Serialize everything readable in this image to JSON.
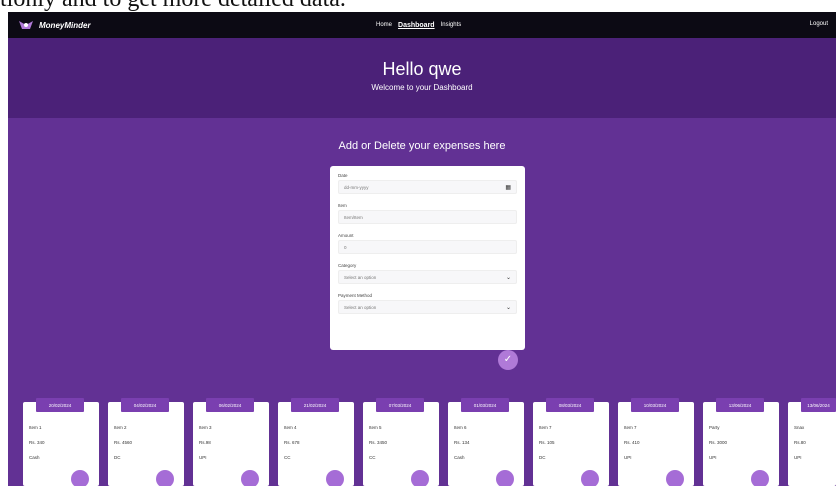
{
  "caption": "tionly and to get more detailed data.",
  "navbar": {
    "brand": "MoneyMinder",
    "links": [
      "Home",
      "Dashboard",
      "Insights"
    ],
    "logout": "Logout"
  },
  "hero": {
    "title": "Hello qwe",
    "subtitle": "Welcome to your Dashboard"
  },
  "section_title": "Add or Delete your expenses here",
  "form": {
    "date_label": "Date",
    "date_value": "dd-mm-yyyy",
    "item_label": "Item",
    "item_placeholder": "Item/Item",
    "amount_label": "Amount",
    "amount_value": "0",
    "category_label": "Category",
    "category_value": "Select an option",
    "payment_label": "Payment Method",
    "payment_value": "Select an option"
  },
  "expenses": [
    {
      "date": "20/02/2024",
      "item": "Item 1",
      "amount": "Rs. 340",
      "method": "Cash"
    },
    {
      "date": "04/02/2024",
      "item": "Item 2",
      "amount": "Rs. 4560",
      "method": "DC"
    },
    {
      "date": "06/02/2024",
      "item": "Item 3",
      "amount": "Rs.98",
      "method": "UPI"
    },
    {
      "date": "21/02/2024",
      "item": "Item 4",
      "amount": "Rs. 678",
      "method": "CC"
    },
    {
      "date": "07/03/2024",
      "item": "Item 5",
      "amount": "Rs. 3450",
      "method": "CC"
    },
    {
      "date": "01/03/2024",
      "item": "Item 6",
      "amount": "Rs. 134",
      "method": "Cash"
    },
    {
      "date": "08/03/2024",
      "item": "Item 7",
      "amount": "Rs. 105",
      "method": "DC"
    },
    {
      "date": "10/03/2024",
      "item": "Item 7",
      "amount": "Rs. 410",
      "method": "UPI"
    },
    {
      "date": "13/06/2024",
      "item": "Party",
      "amount": "Rs. 3000",
      "method": "UPI"
    },
    {
      "date": "13/06/2024",
      "item": "Snax",
      "amount": "Rs.80",
      "method": "UPI"
    }
  ],
  "colors": {
    "navbar": "#0c0a14",
    "hero": "#4b2178",
    "main": "#623194",
    "accent": "#7a3fb0",
    "button": "#b07ad8"
  }
}
